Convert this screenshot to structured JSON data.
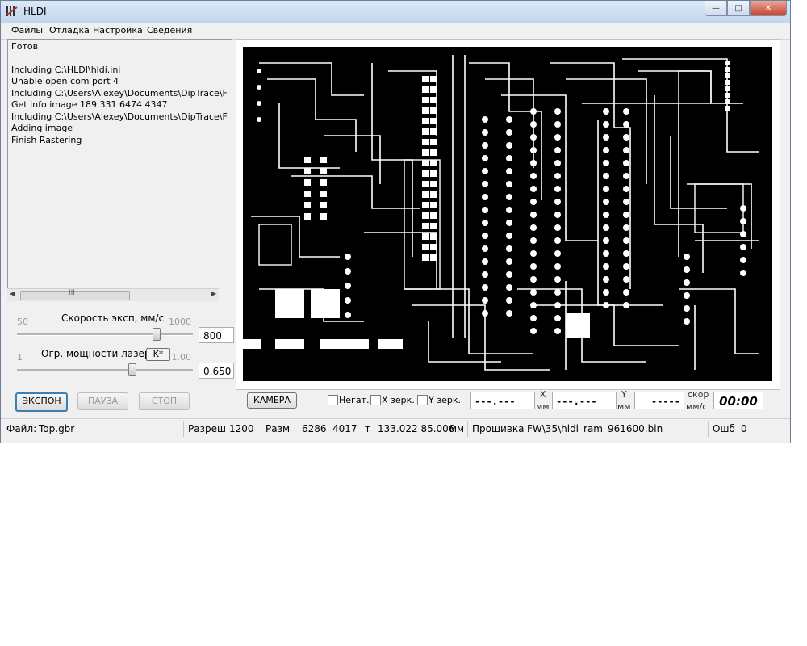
{
  "window": {
    "title": "HLDI"
  },
  "caption": {
    "minimize": "—",
    "maximize": "□",
    "close": "✕"
  },
  "menu": [
    "Файлы",
    "Отладка",
    "Настройка",
    "Сведения"
  ],
  "log": [
    "Готов",
    "",
    "Including C:\\HLDI\\hldi.ini",
    "Unable open com port 4",
    "Including C:\\Users\\Alexey\\Documents\\DipTrace\\F",
    "Get info image 189 331 6474 4347",
    "Including C:\\Users\\Alexey\\Documents\\DipTrace\\F",
    "Adding image",
    "Finish Rastering"
  ],
  "scroll": {
    "left": "◀",
    "right": "▶",
    "grip": "III"
  },
  "speed": {
    "min": "50",
    "max": "1000",
    "label": "Скорость эксп, мм/с",
    "value": "800",
    "level": 0.79
  },
  "power": {
    "min": "1",
    "max": "1.00",
    "label": "Огр. мощности лазера,",
    "k_button": "K*",
    "value": "0.650",
    "level": 0.65
  },
  "buttons": {
    "expose": "ЭКСПОН",
    "pause": "ПАУЗА",
    "stop": "СТОП",
    "camera": "КАМЕРА"
  },
  "checks": {
    "negative": "Негат.",
    "x_mirror": "X зерк.",
    "y_mirror": "Y зерк."
  },
  "readouts": {
    "x": "---.---",
    "y": "---.---",
    "speed": "-----",
    "x_label": "X",
    "y_label": "Y",
    "mm": "мм",
    "speed_label": "скор",
    "speed_unit": "мм/с",
    "timer": "00:00"
  },
  "status": {
    "file_label": "Файл:",
    "file": "Top.gbr",
    "res_label": "Разреш",
    "res": "1200",
    "size_label": "Разм",
    "size_w": "6286",
    "size_h": "4017",
    "t": "т",
    "dims": "133.022 85.006",
    "dims_unit": "мм",
    "fw_label": "Прошивка",
    "fw": "FW\\35\\hldi_ram_961600.bin",
    "err_label": "Ошб",
    "err": "0"
  },
  "colors": {
    "pcb_bg": "#000000",
    "pcb_trace": "#ffffff",
    "accent": "#3c7fb1"
  }
}
